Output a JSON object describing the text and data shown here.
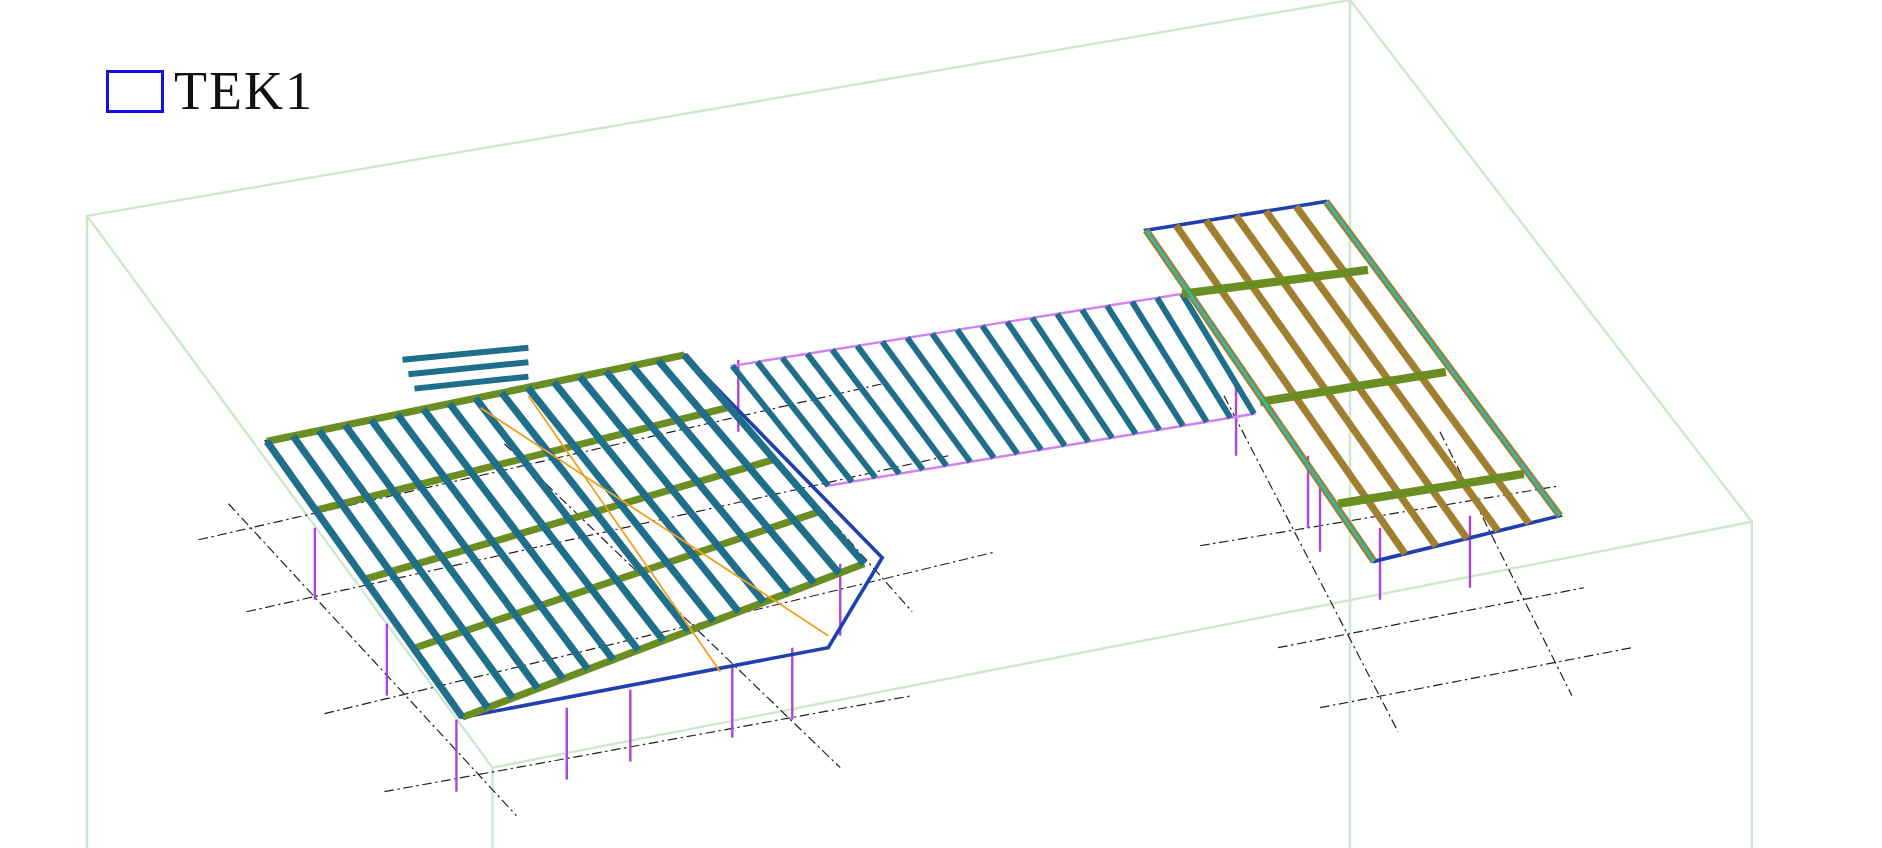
{
  "view": {
    "title": "TEK1"
  }
}
